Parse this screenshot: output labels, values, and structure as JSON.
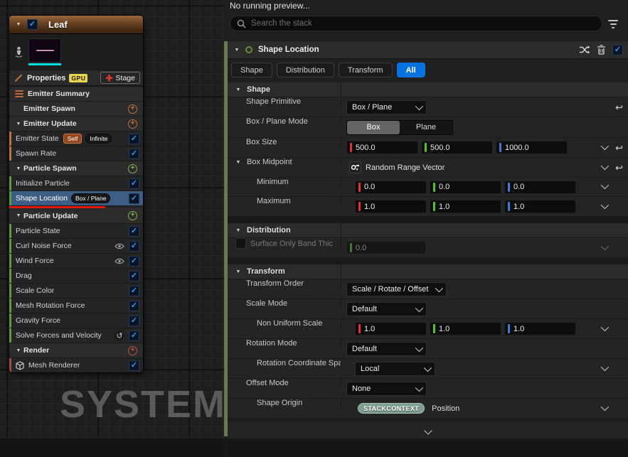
{
  "watermark": "SYSTEM",
  "emitter": {
    "title": "Leaf",
    "properties": {
      "label": "Properties",
      "gpu_badge": "GPU",
      "stage_button": "Stage"
    },
    "stack": [
      {
        "label": "Emitter Summary"
      },
      {
        "label": "Emitter Spawn"
      },
      {
        "label": "Emitter Update"
      },
      {
        "label": "Emitter State",
        "badges": [
          "Self",
          "Infinite"
        ]
      },
      {
        "label": "Spawn Rate"
      },
      {
        "label": "Particle Spawn"
      },
      {
        "label": "Initialize Particle"
      },
      {
        "label": "Shape Location",
        "badge": "Box / Plane"
      },
      {
        "label": "Particle Update"
      },
      {
        "label": "Particle State"
      },
      {
        "label": "Curl Noise Force"
      },
      {
        "label": "Wind Force"
      },
      {
        "label": "Drag"
      },
      {
        "label": "Scale Color"
      },
      {
        "label": "Mesh Rotation Force"
      },
      {
        "label": "Gravity Force"
      },
      {
        "label": "Solve Forces and Velocity"
      },
      {
        "label": "Render"
      },
      {
        "label": "Mesh Renderer"
      }
    ]
  },
  "panel": {
    "preview": "No running preview...",
    "search_placeholder": "Search the stack",
    "header": {
      "title": "Shape Location"
    },
    "tabs": [
      {
        "label": "Shape"
      },
      {
        "label": "Distribution"
      },
      {
        "label": "Transform"
      },
      {
        "label": "All"
      }
    ],
    "active_tab": "All",
    "sections": {
      "shape": {
        "title": "Shape",
        "rows": {
          "primitive": {
            "label": "Shape Primitive",
            "value": "Box / Plane"
          },
          "mode": {
            "label": "Box / Plane Mode",
            "options": [
              "Box",
              "Plane"
            ],
            "selected": "Box"
          },
          "size": {
            "label": "Box Size",
            "values": [
              "500.0",
              "500.0",
              "1000.0"
            ]
          },
          "midpoint": {
            "label": "Box Midpoint",
            "value": "Random Range Vector"
          },
          "minimum": {
            "label": "Minimum",
            "values": [
              "0.0",
              "0.0",
              "0.0"
            ]
          },
          "maximum": {
            "label": "Maximum",
            "values": [
              "1.0",
              "1.0",
              "1.0"
            ]
          }
        }
      },
      "distribution": {
        "title": "Distribution",
        "rows": {
          "band": {
            "label": "Surface Only Band Thic",
            "value": "0.0"
          }
        }
      },
      "transform": {
        "title": "Transform",
        "rows": {
          "order": {
            "label": "Transform Order",
            "value": "Scale / Rotate / Offset"
          },
          "scale_mode": {
            "label": "Scale Mode",
            "value": "Default"
          },
          "non_uniform": {
            "label": "Non Uniform Scale",
            "values": [
              "1.0",
              "1.0",
              "1.0"
            ]
          },
          "rotation_mode": {
            "label": "Rotation Mode",
            "value": "Default"
          },
          "rotation_space": {
            "label": "Rotation Coordinate Spac",
            "value": "Local"
          },
          "offset_mode": {
            "label": "Offset Mode",
            "value": "None"
          },
          "origin": {
            "label": "Shape Origin",
            "badge": "STACKCONTEXT",
            "value": "Position"
          }
        }
      }
    }
  },
  "colors": {
    "accent_blue": "#0873e0",
    "check_blue": "#2e9bff",
    "axis_red": "#e0352b",
    "axis_green": "#4fc32b",
    "axis_blue": "#3a7bd5",
    "selection_blue": "#3d5d84",
    "particle_green": "#5f9a3c",
    "emitter_orange": "#c4703d",
    "render_red": "#a34a3e",
    "position_pink": "#d668c8",
    "context_badge_green": "#7d9f8d",
    "gpu_yellow": "#e8d44d",
    "underline_red": "#e0180c",
    "node_header_orange": "#6b4424"
  }
}
